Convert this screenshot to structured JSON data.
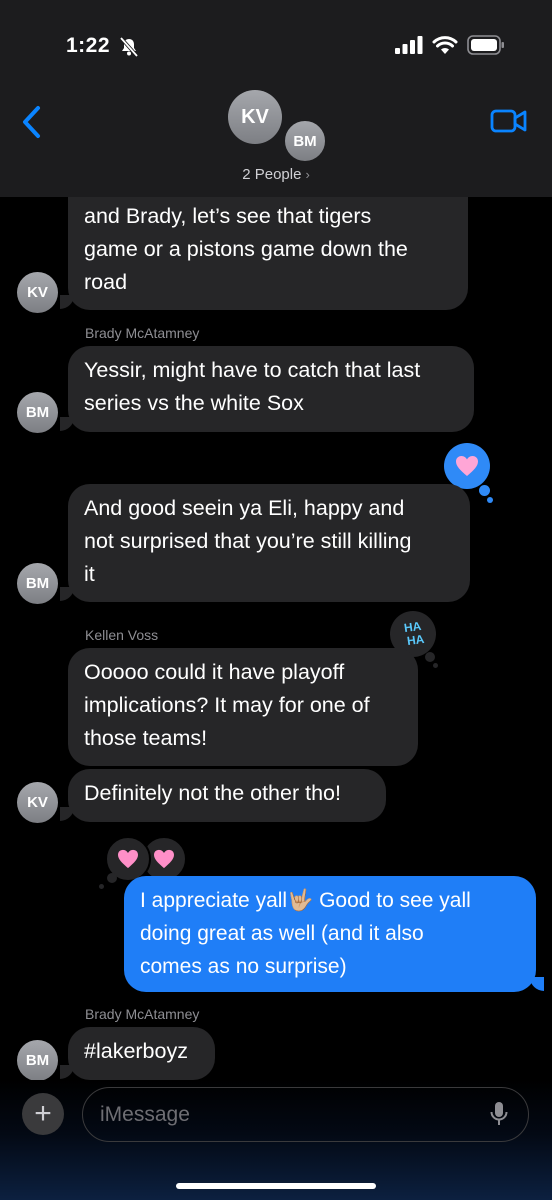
{
  "status_bar": {
    "time": "1:22"
  },
  "header": {
    "avatars": [
      "KV",
      "BM"
    ],
    "people_label": "2 People",
    "chevron": "›"
  },
  "messages": [
    {
      "from": "KV",
      "lines": [
        "and Brady, let’s see that tigers",
        "game or a pistons game down the",
        "road"
      ]
    },
    {
      "sender": "Brady McAtamney",
      "from": "BM",
      "lines": [
        "Yessir, might have to catch that last",
        "series vs the white Sox"
      ]
    },
    {
      "from": "BM",
      "lines": [
        "And good seein ya Eli, happy and",
        "not surprised that you’re still killing",
        "it"
      ],
      "tapback": "heart"
    },
    {
      "sender": "Kellen Voss",
      "from": "KV",
      "lines": [
        "Ooooo could it have playoff",
        "implications? It may for one of",
        "those teams!"
      ],
      "tapback": "haha"
    },
    {
      "from": "KV",
      "lines": [
        "Definitely not the other tho!"
      ]
    },
    {
      "from": "me",
      "lines": [
        "I appreciate yall🤟🏼 Good to see yall",
        "doing great as well (and it also",
        "comes as no surprise)"
      ],
      "tapbacks": [
        "heart",
        "heart"
      ]
    },
    {
      "sender": "Brady McAtamney",
      "from": "BM",
      "lines": [
        "#lakerboyz"
      ]
    }
  ],
  "tapback_labels": {
    "haha_line1": "HA",
    "haha_line2": "HA"
  },
  "input": {
    "placeholder": "iMessage",
    "plus": "+"
  },
  "colors": {
    "outgoing": "#1f7ef7",
    "incoming": "#262628",
    "accent": "#0a84ff",
    "heart": "#ff8fc8"
  }
}
